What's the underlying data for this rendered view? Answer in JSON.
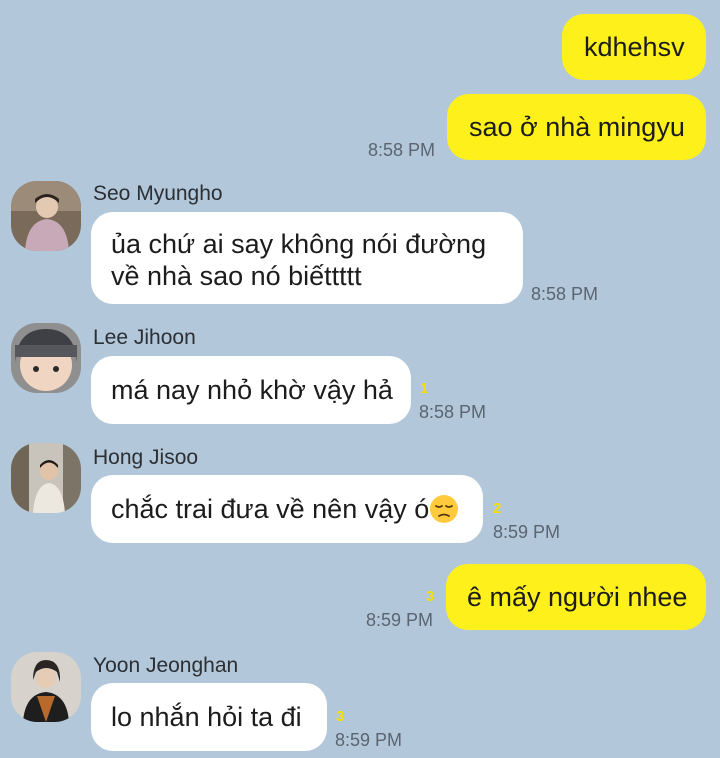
{
  "messages": {
    "m1": {
      "text": "kdhehsv"
    },
    "m2": {
      "text": "sao ở nhà mingyu",
      "time": "8:58 PM"
    },
    "m3": {
      "sender": "Seo Myungho",
      "line1": "ủa chứ ai say không nói đường",
      "line2": "về nhà sao nó biếttttt",
      "time": "8:58 PM"
    },
    "m4": {
      "sender": "Lee Jihoon",
      "text": "má nay nhỏ khờ vậy hả",
      "unread": "1",
      "time": "8:58 PM"
    },
    "m5": {
      "sender": "Hong Jisoo",
      "text": "chắc trai đưa về nên vậy ó",
      "emoji": "pensive-face",
      "unread": "2",
      "time": "8:59 PM"
    },
    "m6": {
      "text": "ê mấy người nhee",
      "unread": "3",
      "time": "8:59 PM"
    },
    "m7": {
      "sender": "Yoon Jeonghan",
      "text": "lo nhắn hỏi ta đi",
      "unread": "3",
      "time": "8:59 PM"
    }
  },
  "colors": {
    "background": "#b2c7da",
    "my_bubble": "#fef01b",
    "their_bubble": "#ffffff",
    "unread_count": "#f5e000"
  }
}
